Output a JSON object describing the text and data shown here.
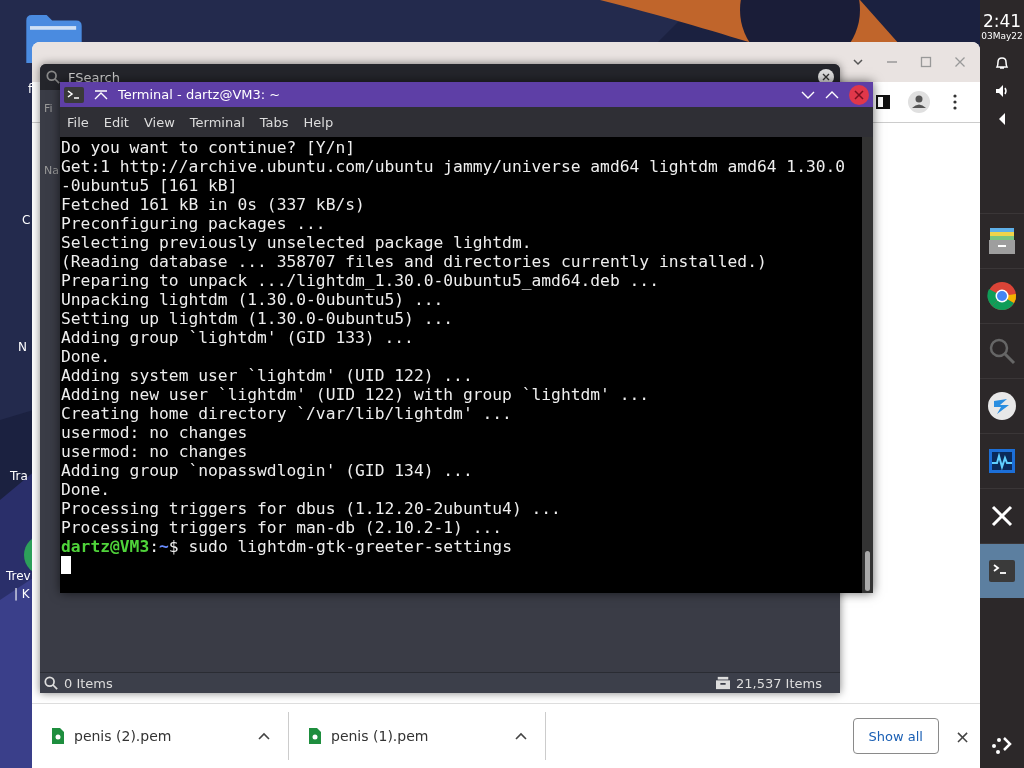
{
  "desktop": {
    "icons": [
      {
        "label": "f"
      },
      {
        "label": "C"
      },
      {
        "label": "N"
      },
      {
        "label": "Tra"
      },
      {
        "label": "Trev"
      },
      {
        "label": "| K"
      }
    ]
  },
  "browser": {
    "downloads": [
      {
        "name": "penis (2).pem"
      },
      {
        "name": "penis (1).pem"
      }
    ],
    "show_all": "Show all",
    "close": "×"
  },
  "fsearch": {
    "title": "FSearch",
    "left_labels": [
      "Fi",
      "Na"
    ],
    "status_left": "0 Items",
    "status_right": "21,537 Items"
  },
  "terminal": {
    "title": "Terminal - dartz@VM3: ~",
    "menu": [
      "File",
      "Edit",
      "View",
      "Terminal",
      "Tabs",
      "Help"
    ],
    "lines": [
      "Do you want to continue? [Y/n]",
      "Get:1 http://archive.ubuntu.com/ubuntu jammy/universe amd64 lightdm amd64 1.30.0",
      "-0ubuntu5 [161 kB]",
      "Fetched 161 kB in 0s (337 kB/s)",
      "Preconfiguring packages ...",
      "Selecting previously unselected package lightdm.",
      "(Reading database ... 358707 files and directories currently installed.)",
      "Preparing to unpack .../lightdm_1.30.0-0ubuntu5_amd64.deb ...",
      "Unpacking lightdm (1.30.0-0ubuntu5) ...",
      "Setting up lightdm (1.30.0-0ubuntu5) ...",
      "Adding group `lightdm' (GID 133) ...",
      "Done.",
      "Adding system user `lightdm' (UID 122) ...",
      "Adding new user `lightdm' (UID 122) with group `lightdm' ...",
      "Creating home directory `/var/lib/lightdm' ...",
      "usermod: no changes",
      "usermod: no changes",
      "Adding group `nopasswdlogin' (GID 134) ...",
      "Done.",
      "Processing triggers for dbus (1.12.20-2ubuntu4) ...",
      "Processing triggers for man-db (2.10.2-1) ..."
    ],
    "prompt": {
      "user": "dartz@VM3",
      "sep": ":",
      "path": "~",
      "symbol": "$",
      "command": " sudo lightdm-gtk-greeter-settings"
    }
  },
  "panel": {
    "time": "2:41",
    "date": "03May22",
    "apps": [
      {
        "kind": "files",
        "selected": false
      },
      {
        "kind": "chrome",
        "selected": false
      },
      {
        "kind": "search",
        "selected": false
      },
      {
        "kind": "kde",
        "selected": false
      },
      {
        "kind": "monitor",
        "selected": false
      },
      {
        "kind": "x",
        "selected": false
      },
      {
        "kind": "terminal",
        "selected": true
      }
    ]
  }
}
